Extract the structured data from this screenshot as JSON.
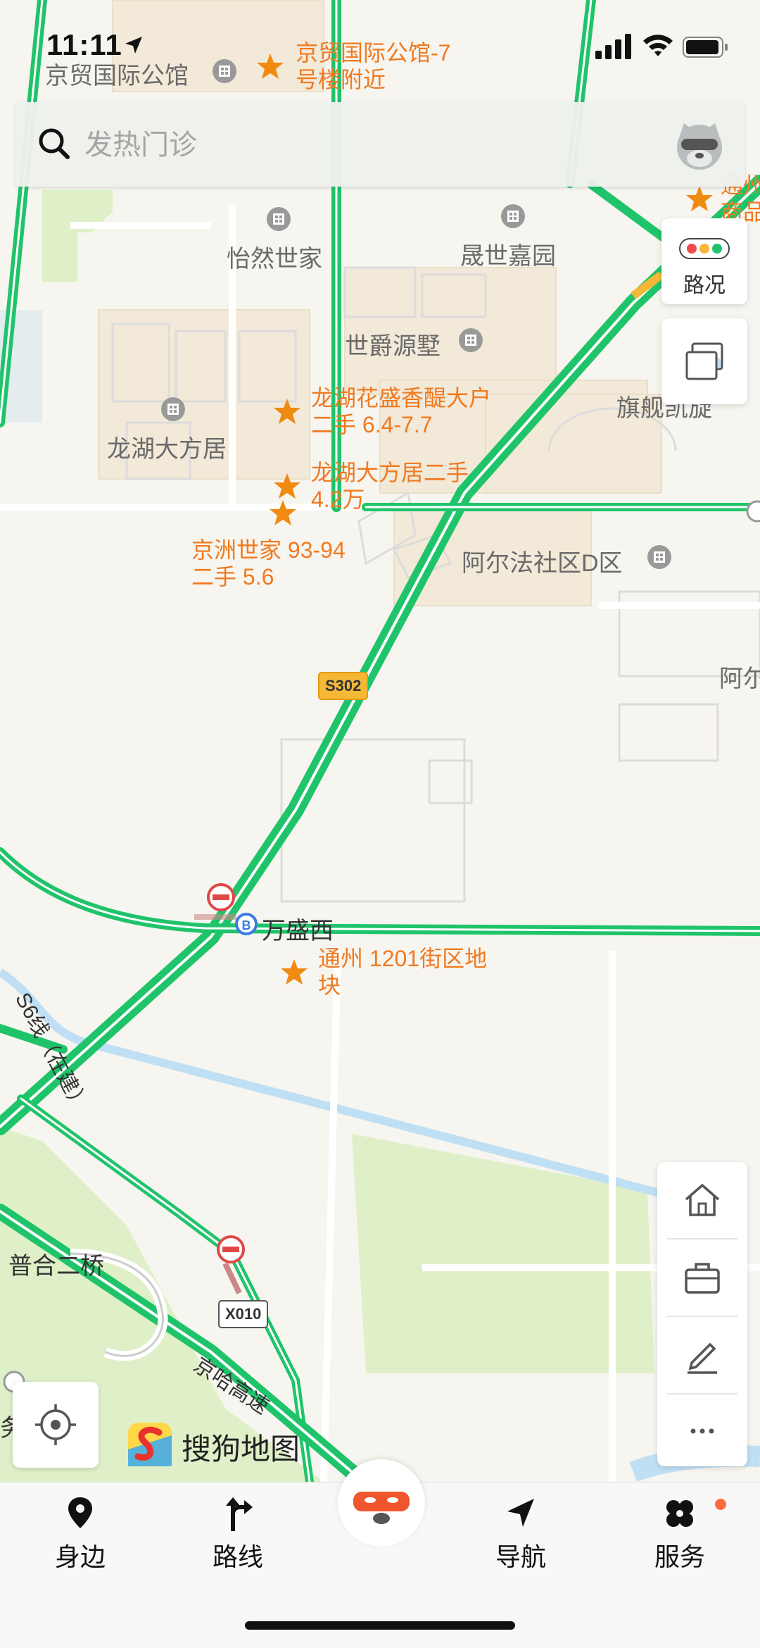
{
  "status_bar": {
    "time": "11:11"
  },
  "search": {
    "placeholder": "发热门诊"
  },
  "right_controls": {
    "traffic_label": "路况"
  },
  "map": {
    "building_labels": {
      "jingmao_guan": "京贸国际公馆",
      "yiran": "怡然世家",
      "shengshi": "晟世嘉园",
      "shijue": "世爵源墅",
      "longhu": "龙湖大方居",
      "qihang": "旗舰凯旋",
      "aerfa_d": "阿尔法社区D区",
      "aerfa_edge": "阿尔"
    },
    "pin_labels": {
      "pin1": "京贸国际公馆-7\n号楼附近",
      "pin2": "龙湖花盛香醍大户\n二手 6.4-7.7",
      "pin3": "龙湖大方居二手\n4.2万",
      "pin4": "京洲世家 93-94\n二手 5.6",
      "pin5": "通州 1201街区地\n块",
      "pin_edge": "通州\n商品"
    },
    "road_shields": {
      "s302": "S302",
      "x010": "X010"
    },
    "places": {
      "wanshengxi": "万盛西",
      "puhe": "普合二桥",
      "edge_left": "务"
    },
    "road_names": {
      "s6": "S6线（在建）",
      "jingha": "京哈高速"
    }
  },
  "brand": {
    "name": "搜狗地图"
  },
  "tabbar": {
    "nearby": "身边",
    "route": "路线",
    "navigate": "导航",
    "service": "服务"
  },
  "colors": {
    "road_green": "#1fc46a",
    "pin_orange": "#f07a20",
    "map_bg": "#f7f5ef",
    "water": "#bfe0f4",
    "park": "#dff0c8"
  }
}
